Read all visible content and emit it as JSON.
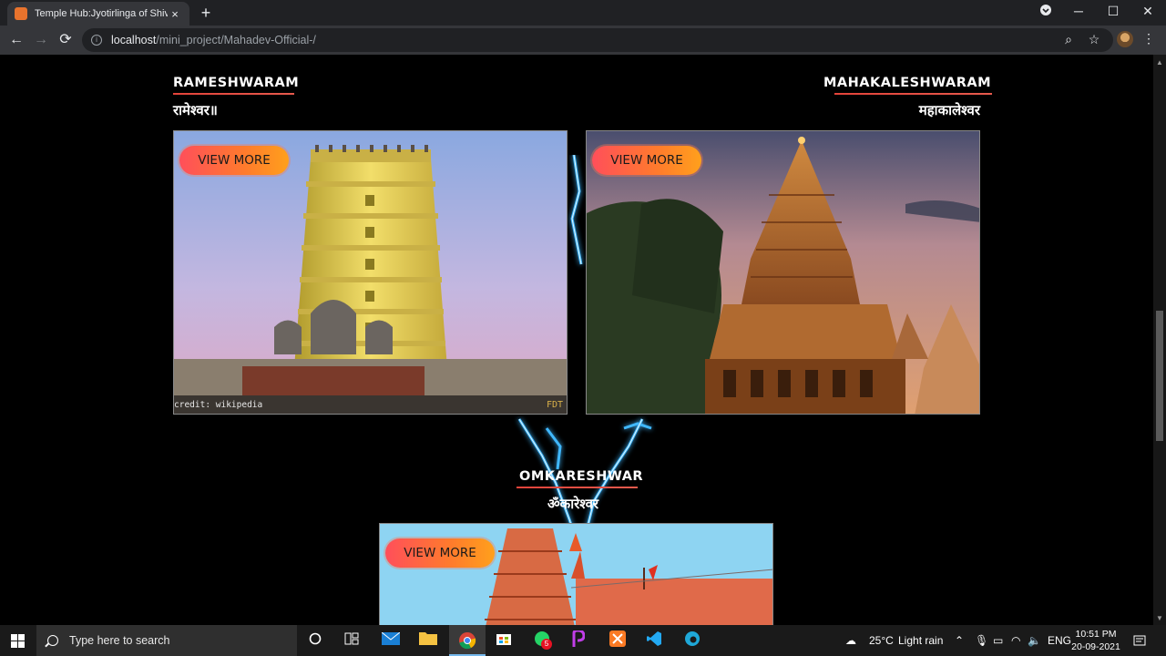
{
  "browser": {
    "tab_title": "Temple Hub:Jyotirlinga of Shiva",
    "tab_close": "×",
    "new_tab": "+",
    "window_minimize": "─",
    "window_maximize": "☐",
    "window_close": "✕",
    "url_host": "localhost",
    "url_path": "/mini_project/Mahadev-Official-/",
    "back": "←",
    "forward": "→",
    "reload": "⟳",
    "zoom_icon": "⌕",
    "bookmark_star": "☆",
    "menu": "⋮"
  },
  "temples": [
    {
      "name_en": "RAMESHWARAM",
      "name_hi": "रामेश्वर॥",
      "button": "VIEW MORE",
      "credit": "credit: wikipedia",
      "watermark": "FDT"
    },
    {
      "name_en": "MAHAKALESHWARAM",
      "name_hi": "महाकालेश्वर",
      "button": "VIEW MORE"
    },
    {
      "name_en": "OMKARESHWAR",
      "name_hi": "ॐकारेश्वर",
      "button": "VIEW MORE"
    }
  ],
  "taskbar": {
    "search_placeholder": "Type here to search",
    "weather_temp": "25°C",
    "weather_text": "Light rain",
    "language": "ENG",
    "time": "10:51 PM",
    "date": "20-09-2021",
    "whatsapp_badge": "5"
  },
  "colors": {
    "button_gradient_start": "#ff4f5a",
    "button_gradient_end": "#ffa01c",
    "heading_underline": "#e4433a",
    "lightning": "#3fb8ff"
  }
}
